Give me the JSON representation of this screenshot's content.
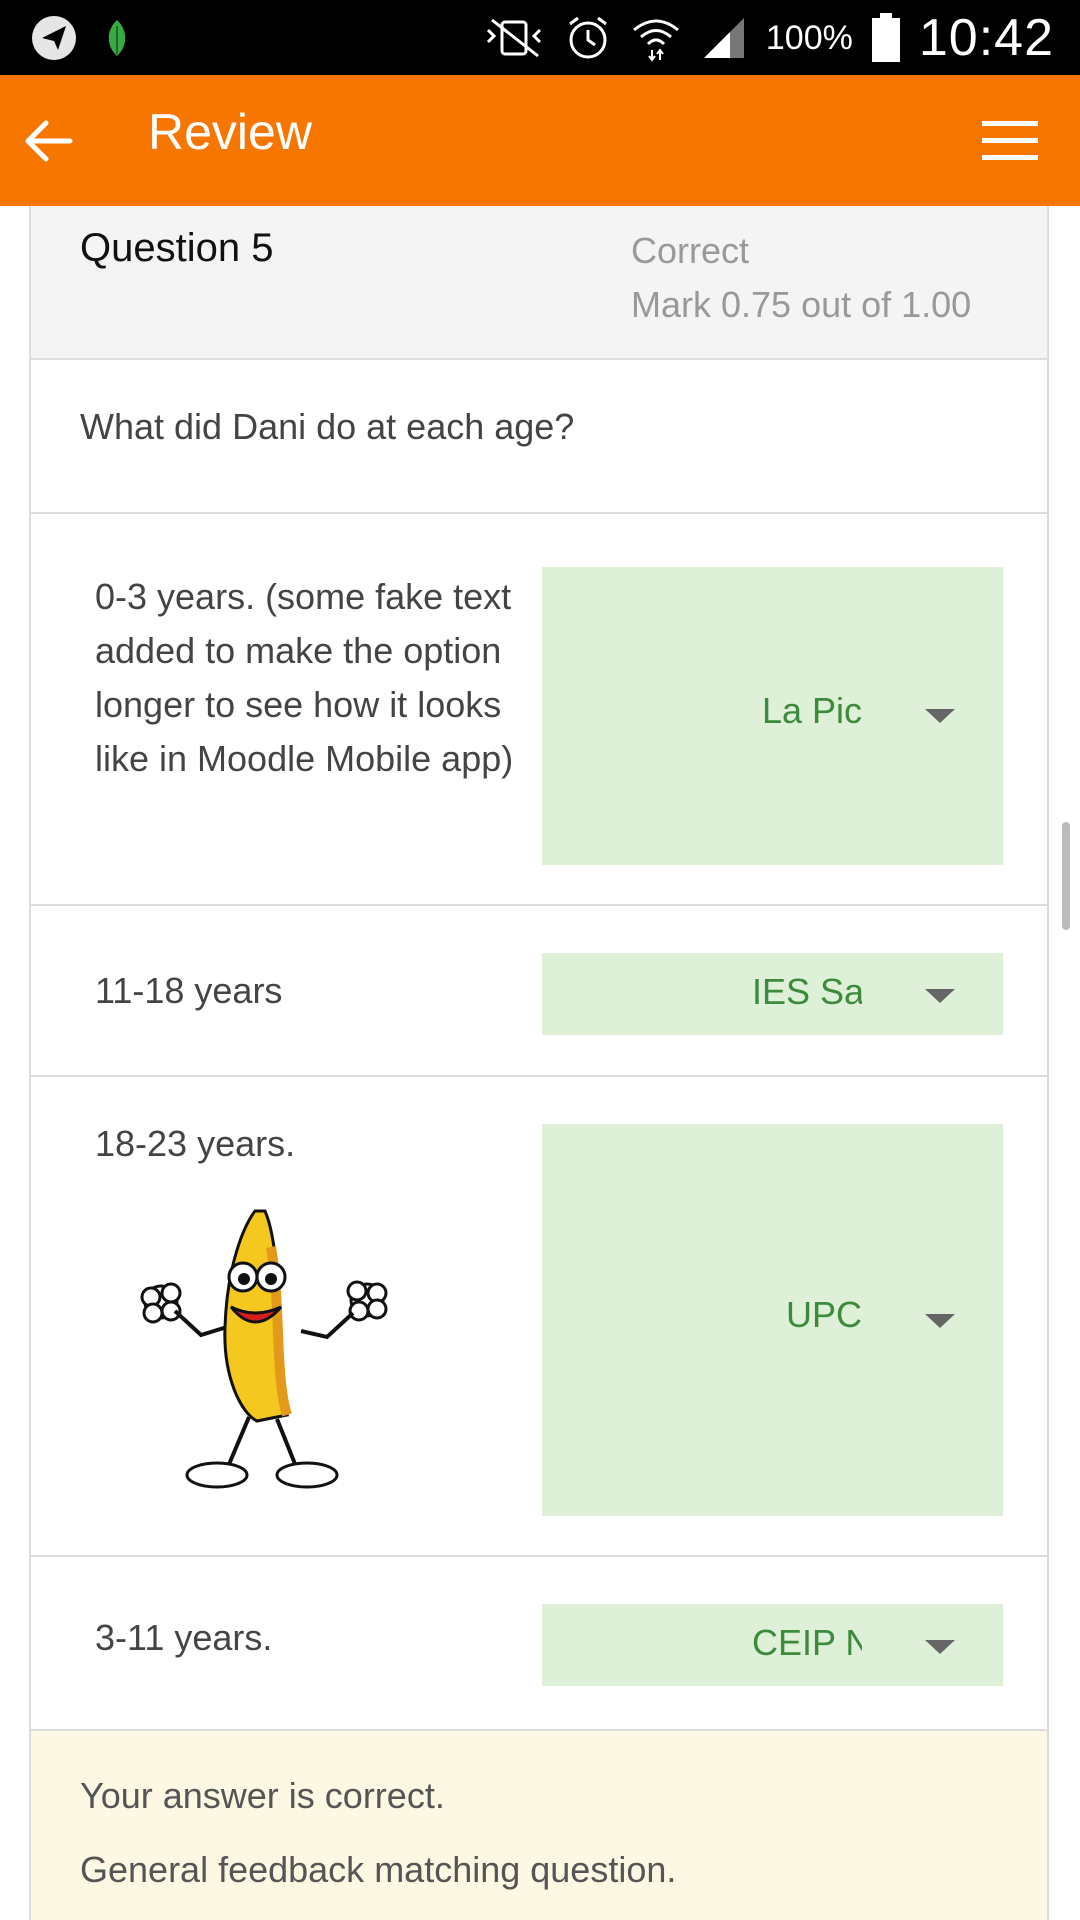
{
  "statusbar": {
    "battery_percent": "100%",
    "time": "10:42"
  },
  "appbar": {
    "title": "Review"
  },
  "question": {
    "number": "Question 5",
    "state": "Correct",
    "mark": "Mark 0.75 out of 1.00",
    "text": "What did Dani do at each age?"
  },
  "matches": [
    {
      "label": "0-3 years. (some fake text added to make the option longer to see how it looks like in Moodle Mobile app)",
      "selected": "La Pic"
    },
    {
      "label": "11-18 years",
      "selected": "IES Sa"
    },
    {
      "label": "18-23 years.",
      "selected": "UPC"
    },
    {
      "label": "3-11 years.",
      "selected": "CEIP N"
    }
  ],
  "feedback": {
    "result": "Your answer is correct.",
    "general": "General feedback matching question."
  },
  "colors": {
    "accent": "#f77600",
    "correct_bg": "#dff0d8",
    "correct_text": "#3c8a3c",
    "feedback_bg": "#fcf8e3"
  }
}
